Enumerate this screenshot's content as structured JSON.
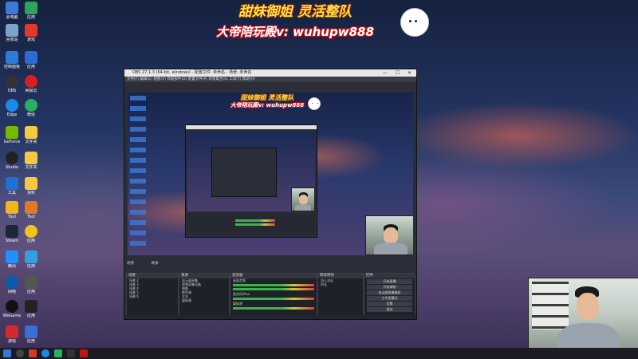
{
  "banner": {
    "line1": "甜妹御姐 灵活整队",
    "line2": "大帝陪玩殿v: wuhupw888"
  },
  "obs_window": {
    "title": "OBS 27.1.3 (64-bit, windows) - 配置文件: 未命名 - 场景: 未命名",
    "menu": "文件(F)  编辑(E)  视图(V)  停靠部件(D)  配置文件(P)  场景集合(S)  工具(T)  帮助(H)",
    "dock_labels": [
      "场景",
      "来源",
      "混音器",
      "转场特效",
      "控件"
    ],
    "scenes": [
      "场景 2",
      "场景 3",
      "场景 4",
      "场景 5",
      "场景 6"
    ],
    "sources": [
      "显示器采集",
      "视频采集设备",
      "图像",
      "颜色源",
      "文本",
      "媒体源"
    ],
    "mixer": [
      "桌面音频",
      "麦克风/Aux",
      "媒体源"
    ],
    "transition": [
      "淡入淡出",
      "时长"
    ],
    "controls": [
      "开始直播",
      "开始录制",
      "启动虚拟摄像机",
      "工作室模式",
      "设置",
      "退出"
    ]
  },
  "colors": {
    "banner_yellow": "#ffe14a",
    "banner_red": "#c0141c",
    "obs_bg": "#2b2e38",
    "taskbar": "#1c1c24"
  }
}
